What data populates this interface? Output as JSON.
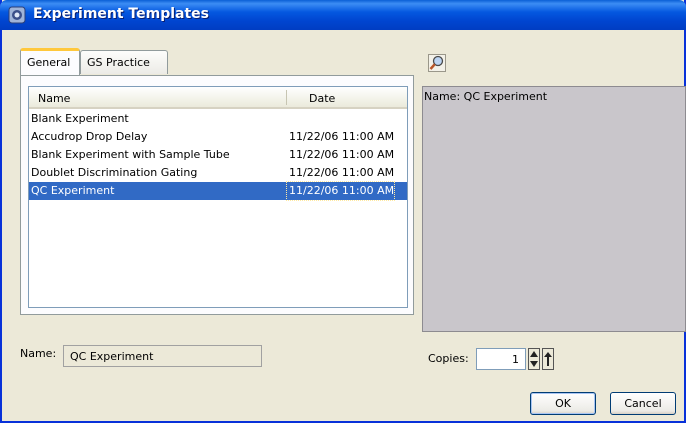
{
  "window": {
    "title": "Experiment Templates"
  },
  "tabs": [
    {
      "label": "General",
      "active": true
    },
    {
      "label": "GS Practice",
      "active": false
    }
  ],
  "list": {
    "columns": [
      "Name",
      "Date"
    ],
    "rows": [
      {
        "name": "Blank Experiment",
        "date": ""
      },
      {
        "name": "Accudrop Drop Delay",
        "date": "11/22/06 11:00 AM"
      },
      {
        "name": "Blank Experiment with Sample Tube",
        "date": "11/22/06 11:00 AM"
      },
      {
        "name": "Doublet Discrimination Gating",
        "date": "11/22/06 11:00 AM"
      },
      {
        "name": "QC Experiment",
        "date": "11/22/06 11:00 AM",
        "selected": true
      }
    ]
  },
  "preview": {
    "text": "Name: QC Experiment",
    "icon": "magnifier-icon"
  },
  "name_field": {
    "label": "Name:",
    "value": "QC Experiment"
  },
  "copies": {
    "label": "Copies:",
    "value": "1"
  },
  "buttons": {
    "ok": "OK",
    "cancel": "Cancel"
  },
  "colors": {
    "titlebar": "#0458e0",
    "selection": "#316ac5",
    "preview_bg": "#c9c6cb",
    "dialog_bg": "#ece9d8"
  }
}
